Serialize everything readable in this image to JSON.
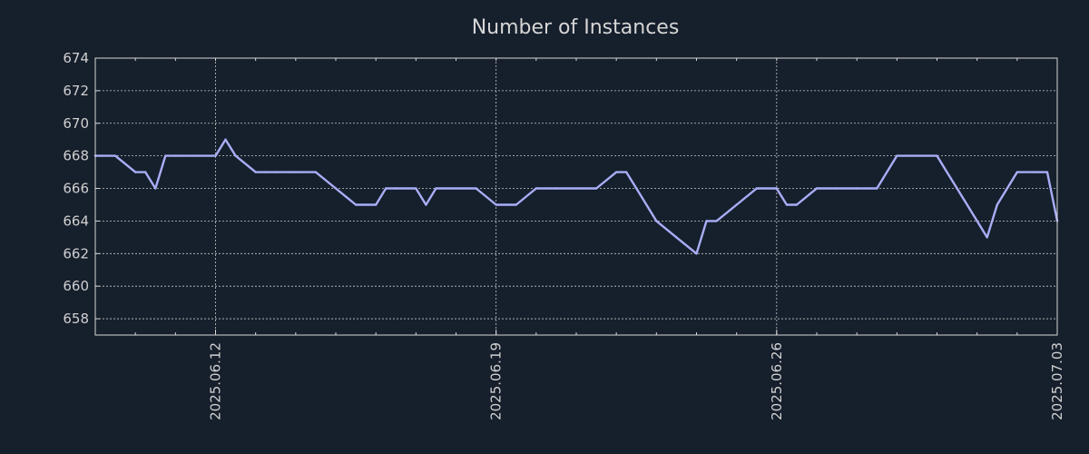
{
  "chart_data": {
    "type": "line",
    "title": "Number of Instances",
    "xlabel": "",
    "ylabel": "",
    "ylim": [
      657,
      674
    ],
    "yticks": [
      658,
      660,
      662,
      664,
      666,
      668,
      670,
      672,
      674
    ],
    "xlim": [
      "2025.06.09",
      "2025.07.03"
    ],
    "xticks": [
      "2025.06.12",
      "2025.06.19",
      "2025.06.26",
      "2025.07.03"
    ],
    "grid": true,
    "colors": {
      "background": "#161f2c",
      "line": "#a9adf6",
      "text": "#d0d0d0",
      "grid": "#c8c8c8"
    },
    "series": [
      {
        "x": [
          "2025.06.09 00:00",
          "2025.06.09 12:00",
          "2025.06.10 00:00",
          "2025.06.10 06:00",
          "2025.06.10 12:00",
          "2025.06.10 18:00",
          "2025.06.11 00:00",
          "2025.06.11 12:00",
          "2025.06.12 00:00",
          "2025.06.12 06:00",
          "2025.06.12 12:00",
          "2025.06.13 00:00",
          "2025.06.13 06:00",
          "2025.06.13 12:00",
          "2025.06.14 00:00",
          "2025.06.14 12:00",
          "2025.06.15 00:00",
          "2025.06.15 12:00",
          "2025.06.16 00:00",
          "2025.06.16 06:00",
          "2025.06.16 12:00",
          "2025.06.17 00:00",
          "2025.06.17 06:00",
          "2025.06.17 12:00",
          "2025.06.18 00:00",
          "2025.06.18 12:00",
          "2025.06.19 00:00",
          "2025.06.19 06:00",
          "2025.06.19 12:00",
          "2025.06.20 00:00",
          "2025.06.20 12:00",
          "2025.06.21 00:00",
          "2025.06.21 12:00",
          "2025.06.22 00:00",
          "2025.06.22 06:00",
          "2025.06.22 12:00",
          "2025.06.23 00:00",
          "2025.06.23 12:00",
          "2025.06.24 00:00",
          "2025.06.24 06:00",
          "2025.06.24 12:00",
          "2025.06.25 00:00",
          "2025.06.25 12:00",
          "2025.06.26 00:00",
          "2025.06.26 06:00",
          "2025.06.26 12:00",
          "2025.06.27 00:00",
          "2025.06.27 12:00",
          "2025.06.28 00:00",
          "2025.06.28 12:00",
          "2025.06.29 00:00",
          "2025.06.29 06:00",
          "2025.06.29 12:00",
          "2025.06.30 00:00",
          "2025.06.30 06:00",
          "2025.06.30 12:00",
          "2025.07.01 00:00",
          "2025.07.01 06:00",
          "2025.07.01 12:00",
          "2025.07.02 00:00",
          "2025.07.02 12:00",
          "2025.07.02 18:00",
          "2025.07.03 00:00"
        ],
        "values": [
          668,
          668,
          667,
          667,
          666,
          668,
          668,
          668,
          668,
          669,
          668,
          667,
          667,
          667,
          667,
          667,
          666,
          665,
          665,
          666,
          666,
          666,
          665,
          666,
          666,
          666,
          665,
          665,
          665,
          666,
          666,
          666,
          666,
          667,
          667,
          666,
          664,
          663,
          662,
          664,
          664,
          665,
          666,
          666,
          665,
          665,
          666,
          666,
          666,
          666,
          668,
          668,
          668,
          668,
          667,
          666,
          664,
          663,
          665,
          667,
          667,
          667,
          664
        ]
      }
    ]
  }
}
